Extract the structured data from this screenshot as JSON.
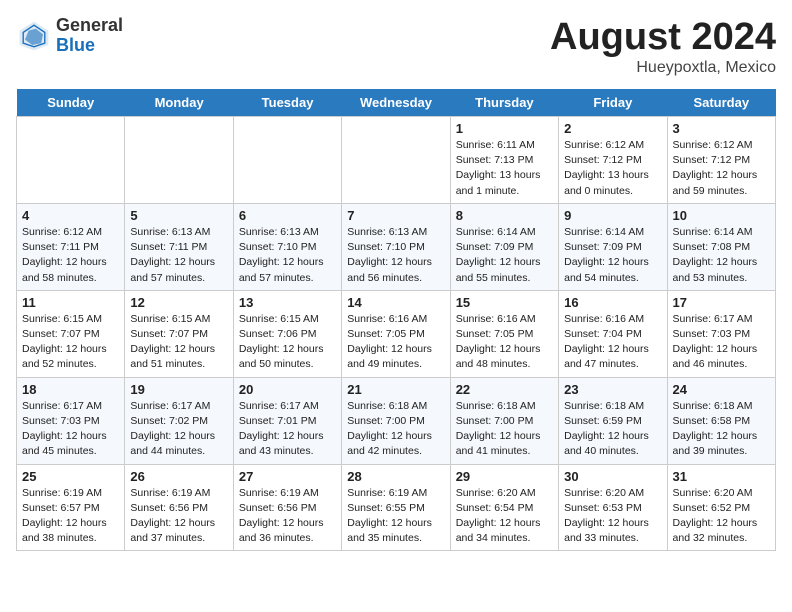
{
  "header": {
    "logo_general": "General",
    "logo_blue": "Blue",
    "month_year": "August 2024",
    "location": "Hueypoxtla, Mexico"
  },
  "weekdays": [
    "Sunday",
    "Monday",
    "Tuesday",
    "Wednesday",
    "Thursday",
    "Friday",
    "Saturday"
  ],
  "weeks": [
    [
      {
        "day": "",
        "info": ""
      },
      {
        "day": "",
        "info": ""
      },
      {
        "day": "",
        "info": ""
      },
      {
        "day": "",
        "info": ""
      },
      {
        "day": "1",
        "info": "Sunrise: 6:11 AM\nSunset: 7:13 PM\nDaylight: 13 hours\nand 1 minute."
      },
      {
        "day": "2",
        "info": "Sunrise: 6:12 AM\nSunset: 7:12 PM\nDaylight: 13 hours\nand 0 minutes."
      },
      {
        "day": "3",
        "info": "Sunrise: 6:12 AM\nSunset: 7:12 PM\nDaylight: 12 hours\nand 59 minutes."
      }
    ],
    [
      {
        "day": "4",
        "info": "Sunrise: 6:12 AM\nSunset: 7:11 PM\nDaylight: 12 hours\nand 58 minutes."
      },
      {
        "day": "5",
        "info": "Sunrise: 6:13 AM\nSunset: 7:11 PM\nDaylight: 12 hours\nand 57 minutes."
      },
      {
        "day": "6",
        "info": "Sunrise: 6:13 AM\nSunset: 7:10 PM\nDaylight: 12 hours\nand 57 minutes."
      },
      {
        "day": "7",
        "info": "Sunrise: 6:13 AM\nSunset: 7:10 PM\nDaylight: 12 hours\nand 56 minutes."
      },
      {
        "day": "8",
        "info": "Sunrise: 6:14 AM\nSunset: 7:09 PM\nDaylight: 12 hours\nand 55 minutes."
      },
      {
        "day": "9",
        "info": "Sunrise: 6:14 AM\nSunset: 7:09 PM\nDaylight: 12 hours\nand 54 minutes."
      },
      {
        "day": "10",
        "info": "Sunrise: 6:14 AM\nSunset: 7:08 PM\nDaylight: 12 hours\nand 53 minutes."
      }
    ],
    [
      {
        "day": "11",
        "info": "Sunrise: 6:15 AM\nSunset: 7:07 PM\nDaylight: 12 hours\nand 52 minutes."
      },
      {
        "day": "12",
        "info": "Sunrise: 6:15 AM\nSunset: 7:07 PM\nDaylight: 12 hours\nand 51 minutes."
      },
      {
        "day": "13",
        "info": "Sunrise: 6:15 AM\nSunset: 7:06 PM\nDaylight: 12 hours\nand 50 minutes."
      },
      {
        "day": "14",
        "info": "Sunrise: 6:16 AM\nSunset: 7:05 PM\nDaylight: 12 hours\nand 49 minutes."
      },
      {
        "day": "15",
        "info": "Sunrise: 6:16 AM\nSunset: 7:05 PM\nDaylight: 12 hours\nand 48 minutes."
      },
      {
        "day": "16",
        "info": "Sunrise: 6:16 AM\nSunset: 7:04 PM\nDaylight: 12 hours\nand 47 minutes."
      },
      {
        "day": "17",
        "info": "Sunrise: 6:17 AM\nSunset: 7:03 PM\nDaylight: 12 hours\nand 46 minutes."
      }
    ],
    [
      {
        "day": "18",
        "info": "Sunrise: 6:17 AM\nSunset: 7:03 PM\nDaylight: 12 hours\nand 45 minutes."
      },
      {
        "day": "19",
        "info": "Sunrise: 6:17 AM\nSunset: 7:02 PM\nDaylight: 12 hours\nand 44 minutes."
      },
      {
        "day": "20",
        "info": "Sunrise: 6:17 AM\nSunset: 7:01 PM\nDaylight: 12 hours\nand 43 minutes."
      },
      {
        "day": "21",
        "info": "Sunrise: 6:18 AM\nSunset: 7:00 PM\nDaylight: 12 hours\nand 42 minutes."
      },
      {
        "day": "22",
        "info": "Sunrise: 6:18 AM\nSunset: 7:00 PM\nDaylight: 12 hours\nand 41 minutes."
      },
      {
        "day": "23",
        "info": "Sunrise: 6:18 AM\nSunset: 6:59 PM\nDaylight: 12 hours\nand 40 minutes."
      },
      {
        "day": "24",
        "info": "Sunrise: 6:18 AM\nSunset: 6:58 PM\nDaylight: 12 hours\nand 39 minutes."
      }
    ],
    [
      {
        "day": "25",
        "info": "Sunrise: 6:19 AM\nSunset: 6:57 PM\nDaylight: 12 hours\nand 38 minutes."
      },
      {
        "day": "26",
        "info": "Sunrise: 6:19 AM\nSunset: 6:56 PM\nDaylight: 12 hours\nand 37 minutes."
      },
      {
        "day": "27",
        "info": "Sunrise: 6:19 AM\nSunset: 6:56 PM\nDaylight: 12 hours\nand 36 minutes."
      },
      {
        "day": "28",
        "info": "Sunrise: 6:19 AM\nSunset: 6:55 PM\nDaylight: 12 hours\nand 35 minutes."
      },
      {
        "day": "29",
        "info": "Sunrise: 6:20 AM\nSunset: 6:54 PM\nDaylight: 12 hours\nand 34 minutes."
      },
      {
        "day": "30",
        "info": "Sunrise: 6:20 AM\nSunset: 6:53 PM\nDaylight: 12 hours\nand 33 minutes."
      },
      {
        "day": "31",
        "info": "Sunrise: 6:20 AM\nSunset: 6:52 PM\nDaylight: 12 hours\nand 32 minutes."
      }
    ]
  ]
}
